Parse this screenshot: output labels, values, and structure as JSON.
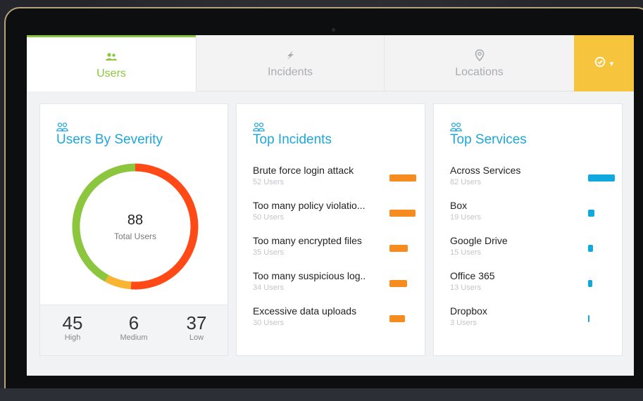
{
  "tabs": [
    {
      "label": "Users",
      "icon": "users-icon",
      "active": true
    },
    {
      "label": "Incidents",
      "icon": "bolt-icon",
      "active": false
    },
    {
      "label": "Locations",
      "icon": "map-pin-icon",
      "active": false
    }
  ],
  "action_tab": {
    "icon": "check-circle-icon",
    "caret": "▾",
    "color": "#f7c43d"
  },
  "severity": {
    "title": "Users By Severity",
    "total": "88",
    "total_label": "Total Users",
    "high": {
      "value": "45",
      "label": "High",
      "count": 45,
      "color": "#ff4a17"
    },
    "medium": {
      "value": "6",
      "label": "Medium",
      "count": 6,
      "color": "#f9b531"
    },
    "low": {
      "value": "37",
      "label": "Low",
      "count": 37,
      "color": "#8cc63f"
    }
  },
  "incidents": {
    "title": "Top Incidents",
    "items": [
      {
        "name": "Brute force login attack",
        "sub": "52 Users",
        "users": 52
      },
      {
        "name": "Too many policy violatio...",
        "sub": "50 Users",
        "users": 50
      },
      {
        "name": "Too many encrypted files",
        "sub": "35 Users",
        "users": 35
      },
      {
        "name": "Too many suspicious log..",
        "sub": "34 Users",
        "users": 34
      },
      {
        "name": "Excessive data uploads",
        "sub": "30 Users",
        "users": 30
      }
    ]
  },
  "services": {
    "title": "Top Services",
    "items": [
      {
        "name": "Across Services",
        "sub": "82 Users",
        "users": 82
      },
      {
        "name": "Box",
        "sub": "19 Users",
        "users": 19
      },
      {
        "name": "Google Drive",
        "sub": "15 Users",
        "users": 15
      },
      {
        "name": "Office 365",
        "sub": "13 Users",
        "users": 13
      },
      {
        "name": "Dropbox",
        "sub": "3 Users",
        "users": 3
      }
    ]
  },
  "colors": {
    "accent": "#8cc63f",
    "title": "#1fa6d9",
    "incident_bar": "#f68b1f",
    "service_bar": "#11a8e0"
  }
}
